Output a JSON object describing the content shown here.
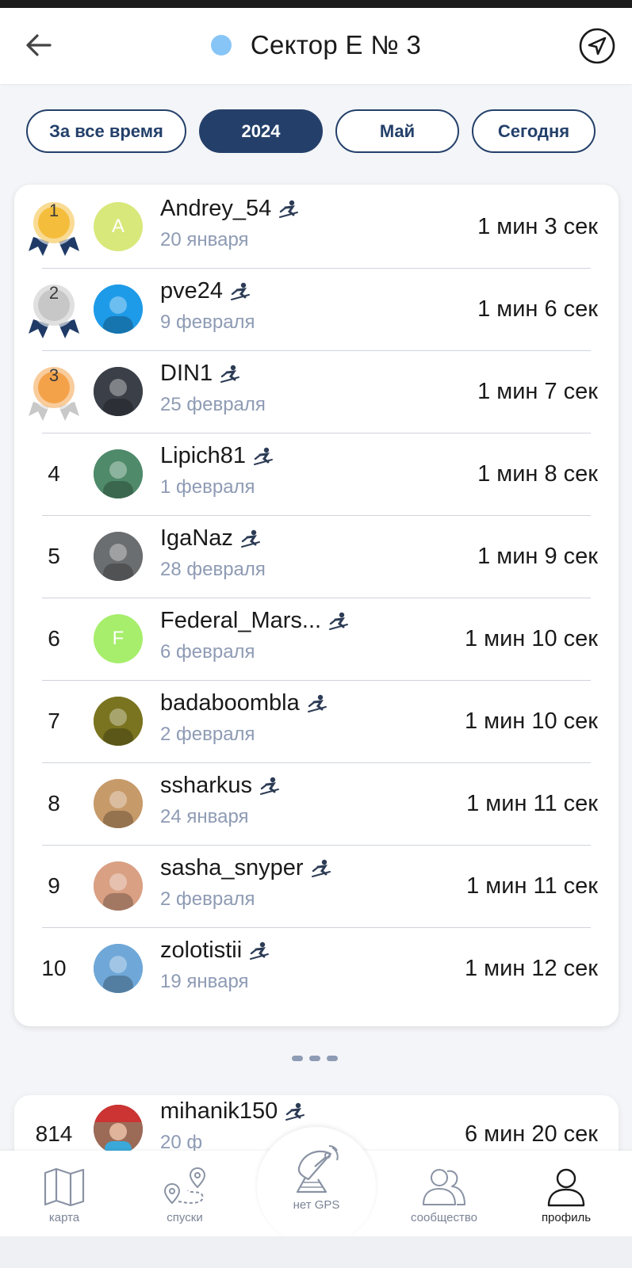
{
  "header": {
    "title": "Сектор Е № 3",
    "dot_color": "#88c5f7"
  },
  "filters": [
    {
      "label": "За все время",
      "active": false
    },
    {
      "label": "2024",
      "active": true
    },
    {
      "label": "Май",
      "active": false
    },
    {
      "label": "Сегодня",
      "active": false
    }
  ],
  "leaderboard": [
    {
      "rank": "1",
      "name": "Andrey_54",
      "date": "20 января",
      "time": "1 мин 3 сек",
      "avatar": {
        "letter": "A",
        "color": "#d8e87a"
      },
      "medal": "gold"
    },
    {
      "rank": "2",
      "name": "pve24",
      "date": "9 февраля",
      "time": "1 мин 6 сек",
      "avatar": {
        "color": "#1e9be8",
        "photo": true
      },
      "medal": "silver"
    },
    {
      "rank": "3",
      "name": "DIN1",
      "date": "25 февраля",
      "time": "1 мин 7 сек",
      "avatar": {
        "color": "#3b4048",
        "photo": true
      },
      "medal": "bronze"
    },
    {
      "rank": "4",
      "name": "Lipich81",
      "date": "1 февраля",
      "time": "1 мин 8 сек",
      "avatar": {
        "color": "#4f8a6a",
        "photo": true
      }
    },
    {
      "rank": "5",
      "name": "IgaNaz",
      "date": "28 февраля",
      "time": "1 мин 9 сек",
      "avatar": {
        "color": "#6b6e70",
        "photo": true
      }
    },
    {
      "rank": "6",
      "name": "Federal_Mars...",
      "date": "6 февраля",
      "time": "1 мин 10 сек",
      "avatar": {
        "letter": "F",
        "color": "#a6ee6c"
      }
    },
    {
      "rank": "7",
      "name": "badaboombla",
      "date": "2 февраля",
      "time": "1 мин 10 сек",
      "avatar": {
        "color": "#7a7420",
        "photo": true
      }
    },
    {
      "rank": "8",
      "name": "ssharkus",
      "date": "24 января",
      "time": "1 мин 11 сек",
      "avatar": {
        "color": "#c79a6a",
        "photo": true
      }
    },
    {
      "rank": "9",
      "name": "sasha_snyper",
      "date": "2 февраля",
      "time": "1 мин 11 сек",
      "avatar": {
        "color": "#d9a084",
        "photo": true
      }
    },
    {
      "rank": "10",
      "name": "zolotistii",
      "date": "19 января",
      "time": "1 мин 12 сек",
      "avatar": {
        "color": "#6fa8d8",
        "photo": true
      }
    }
  ],
  "my_result": {
    "rank": "814",
    "name": "mihanik150",
    "date": "20 ф",
    "time": "6 мин 20 сек",
    "avatar": {
      "color": "#8a5a4a",
      "photo": true
    }
  },
  "tabbar": {
    "map": "карта",
    "descents": "спуски",
    "gps": "нет GPS",
    "community": "сообщество",
    "profile": "профиль"
  },
  "colors": {
    "accent": "#24406a",
    "date_text": "#8e9bb4",
    "gold": "#f4bd3c",
    "silver": "#c7c7c7",
    "bronze": "#f4a24a",
    "ribbon_dark": "#1f3a66"
  }
}
